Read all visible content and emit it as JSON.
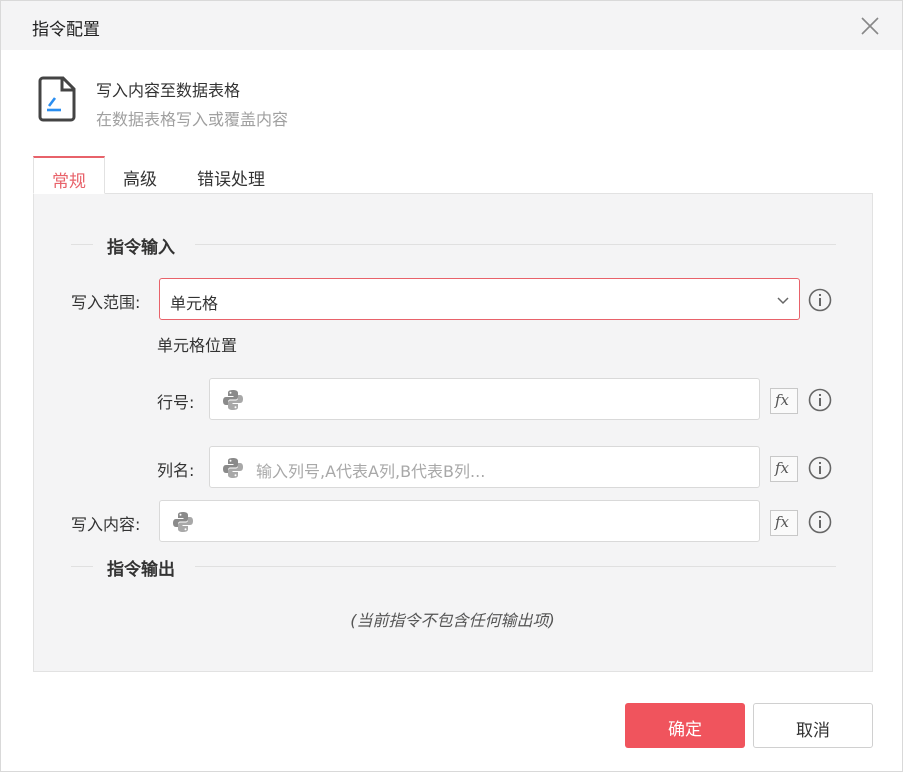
{
  "dialog": {
    "title": "指令配置"
  },
  "command": {
    "name": "写入内容至数据表格",
    "description": "在数据表格写入或覆盖内容"
  },
  "tabs": [
    {
      "label": "常规",
      "active": true
    },
    {
      "label": "高级",
      "active": false
    },
    {
      "label": "错误处理",
      "active": false
    }
  ],
  "sections": {
    "input_title": "指令输入",
    "output_title": "指令输出"
  },
  "fields": {
    "range": {
      "label": "写入范围:",
      "value": "单元格"
    },
    "cell_position_label": "单元格位置",
    "row": {
      "label": "行号:",
      "value": ""
    },
    "column": {
      "label": "列名:",
      "placeholder": "输入列号,A代表A列,B代表B列..."
    },
    "content": {
      "label": "写入内容:",
      "value": ""
    }
  },
  "output_empty": "(当前指令不包含任何输出项)",
  "buttons": {
    "ok": "确定",
    "cancel": "取消"
  },
  "icons": {
    "close": "close-icon",
    "command": "document-write-icon",
    "python": "python-icon",
    "fx": "fx-icon",
    "info": "info-icon",
    "chevron": "chevron-down-icon"
  },
  "colors": {
    "accent": "#f0545d",
    "tab_active": "#e8626a",
    "panel_bg": "#f4f4f5"
  }
}
